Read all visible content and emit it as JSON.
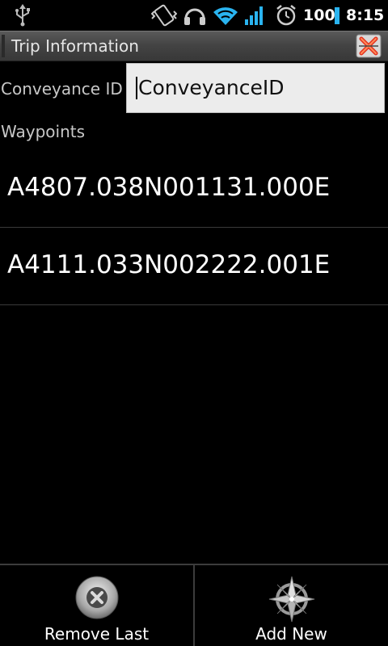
{
  "status_bar": {
    "battery": "100",
    "time": "8:15",
    "icons": [
      "usb-icon",
      "vibrate-icon",
      "headset-icon",
      "wifi-icon",
      "signal-icon",
      "alarm-icon",
      "battery-icon"
    ]
  },
  "title_bar": {
    "title": "Trip Information",
    "close_icon": "close-app-icon"
  },
  "form": {
    "conveyance_label": "Conveyance ID",
    "conveyance_value": "ConveyanceID",
    "waypoints_label": "Waypoints"
  },
  "waypoints": [
    {
      "text": "A4807.038N001131.000E"
    },
    {
      "text": "A4111.033N002222.001E"
    }
  ],
  "bottom_bar": {
    "remove_label": "Remove Last",
    "remove_icon": "remove-circle-icon",
    "add_label": "Add New",
    "add_icon": "compass-rose-icon"
  },
  "colors": {
    "background": "#000000",
    "accent": "#2ab4f0",
    "input_bg": "#ececec"
  }
}
